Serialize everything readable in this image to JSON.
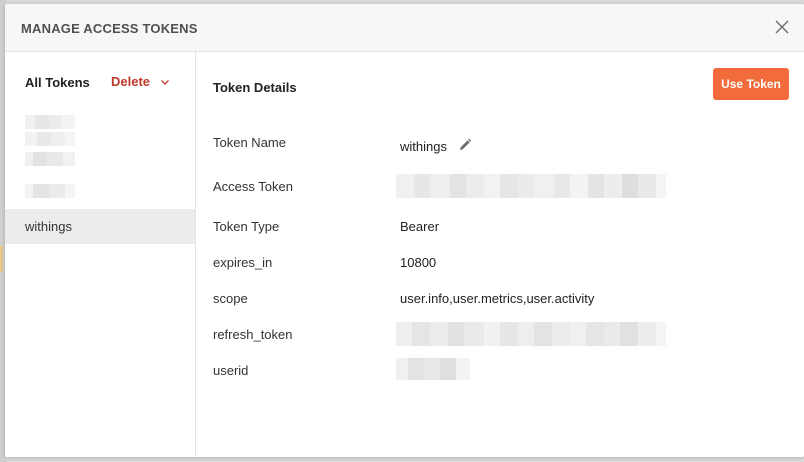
{
  "modal": {
    "title": "MANAGE ACCESS TOKENS",
    "close_icon": "close-icon"
  },
  "sidebar": {
    "all_tokens_label": "All Tokens",
    "delete_label": "Delete",
    "delete_icon": "chevron-down-icon",
    "selected_token": "withings"
  },
  "details": {
    "title": "Token Details",
    "use_token_label": "Use Token",
    "edit_icon": "pencil-icon",
    "rows": [
      {
        "label": "Token Name",
        "value": "withings"
      },
      {
        "label": "Access Token",
        "value": ""
      },
      {
        "label": "Token Type",
        "value": "Bearer"
      },
      {
        "label": "expires_in",
        "value": "10800"
      },
      {
        "label": "scope",
        "value": "user.info,user.metrics,user.activity"
      },
      {
        "label": "refresh_token",
        "value": ""
      },
      {
        "label": "userid",
        "value": ""
      }
    ]
  },
  "colors": {
    "accent": "#f26b3a",
    "delete": "#c0392b",
    "selected_bg": "#ececec"
  }
}
